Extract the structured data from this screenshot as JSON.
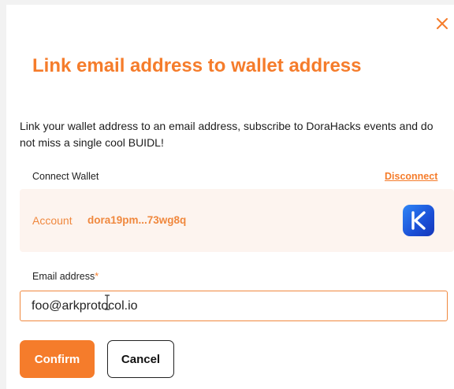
{
  "dialog": {
    "title": "Link email address to wallet address",
    "description": "Link your wallet address to an email address, subscribe to DoraHacks events and do not miss a single cool BUIDL!",
    "close_icon": "close-icon"
  },
  "wallet": {
    "section_label": "Connect Wallet",
    "disconnect_label": "Disconnect",
    "account_label": "Account",
    "account_value": "dora19pm...73wg8q",
    "logo_letter": "K",
    "logo_icon": "keplr-wallet-icon"
  },
  "email": {
    "label": "Email address",
    "required_mark": "*",
    "value": "foo@arkprotocol.io"
  },
  "actions": {
    "confirm_label": "Confirm",
    "cancel_label": "Cancel"
  },
  "colors": {
    "accent": "#f57c2b",
    "account_bg": "#fdf4ef"
  }
}
